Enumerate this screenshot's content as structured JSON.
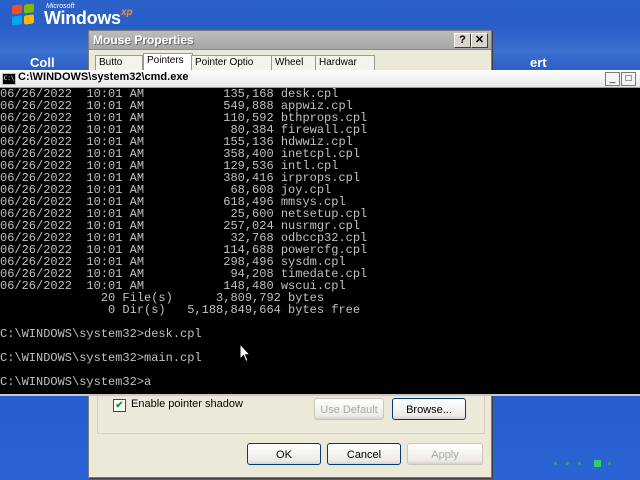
{
  "desktop": {
    "logo": {
      "microsoft": "Microsoft",
      "windows": "Windows",
      "xp": "xp"
    },
    "fragments": {
      "left": "Coll",
      "right": "ert"
    }
  },
  "mouse_properties": {
    "title": "Mouse Properties",
    "help_button": "?",
    "close_button": "✕",
    "tabs": [
      "Butto",
      "Pointers",
      "Pointer Optio",
      "Wheel",
      "Hardwar"
    ],
    "checkbox_checked": true,
    "checkbox_label": "Enable pointer shadow",
    "use_default_button": "Use Default",
    "browse_button": "Browse...",
    "ok_button": "OK",
    "cancel_button": "Cancel",
    "apply_button": "Apply"
  },
  "cmd": {
    "title": "C:\\WINDOWS\\system32\\cmd.exe",
    "minimize": "_",
    "maximize": "□",
    "lines": [
      "06/26/2022  10:01 AM           135,168 desk.cpl",
      "06/26/2022  10:01 AM           549,888 appwiz.cpl",
      "06/26/2022  10:01 AM           110,592 bthprops.cpl",
      "06/26/2022  10:01 AM            80,384 firewall.cpl",
      "06/26/2022  10:01 AM           155,136 hdwwiz.cpl",
      "06/26/2022  10:01 AM           358,400 inetcpl.cpl",
      "06/26/2022  10:01 AM           129,536 intl.cpl",
      "06/26/2022  10:01 AM           380,416 irprops.cpl",
      "06/26/2022  10:01 AM            68,608 joy.cpl",
      "06/26/2022  10:01 AM           618,496 mmsys.cpl",
      "06/26/2022  10:01 AM            25,600 netsetup.cpl",
      "06/26/2022  10:01 AM           257,024 nusrmgr.cpl",
      "06/26/2022  10:01 AM            32,768 odbccp32.cpl",
      "06/26/2022  10:01 AM           114,688 powercfg.cpl",
      "06/26/2022  10:01 AM           298,496 sysdm.cpl",
      "06/26/2022  10:01 AM            94,208 timedate.cpl",
      "06/26/2022  10:01 AM           148,480 wscui.cpl",
      "              20 File(s)      3,809,792 bytes",
      "               0 Dir(s)   5,188,849,664 bytes free",
      "",
      "C:\\WINDOWS\\system32>desk.cpl",
      "",
      "C:\\WINDOWS\\system32>main.cpl",
      "",
      "C:\\WINDOWS\\system32>a"
    ]
  }
}
